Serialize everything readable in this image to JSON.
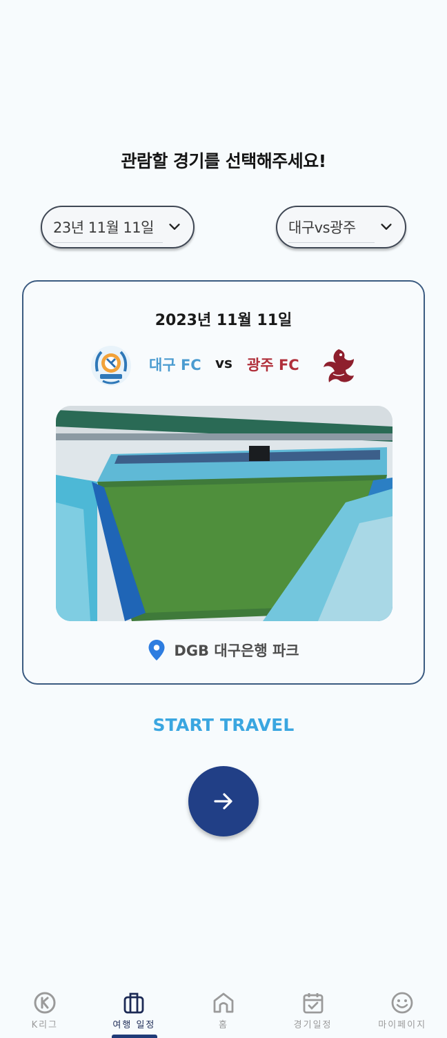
{
  "prompt": "관람할 경기를 선택해주세요!",
  "date_select": {
    "value": "23년 11월 11일",
    "icon": "chevron-down-icon"
  },
  "match_select": {
    "value": "대구vs광주",
    "icon": "chevron-down-icon"
  },
  "card": {
    "date": "2023년 11월 11일",
    "home_team": "대구 FC",
    "vs": "vs",
    "away_team": "광주 FC",
    "venue": "DGB 대구은행 파크"
  },
  "start_label": "START TRAVEL",
  "colors": {
    "accent": "#3aa6e0",
    "primary": "#213f86",
    "home": "#4a9bd0",
    "away": "#b02f3a"
  },
  "tabs": [
    {
      "label": "K리그",
      "icon": "k-league-icon",
      "active": false
    },
    {
      "label": "여행 일정",
      "icon": "luggage-icon",
      "active": true
    },
    {
      "label": "홈",
      "icon": "home-icon",
      "active": false
    },
    {
      "label": "경기일정",
      "icon": "calendar-check-icon",
      "active": false
    },
    {
      "label": "마이페이지",
      "icon": "smiley-icon",
      "active": false
    }
  ]
}
